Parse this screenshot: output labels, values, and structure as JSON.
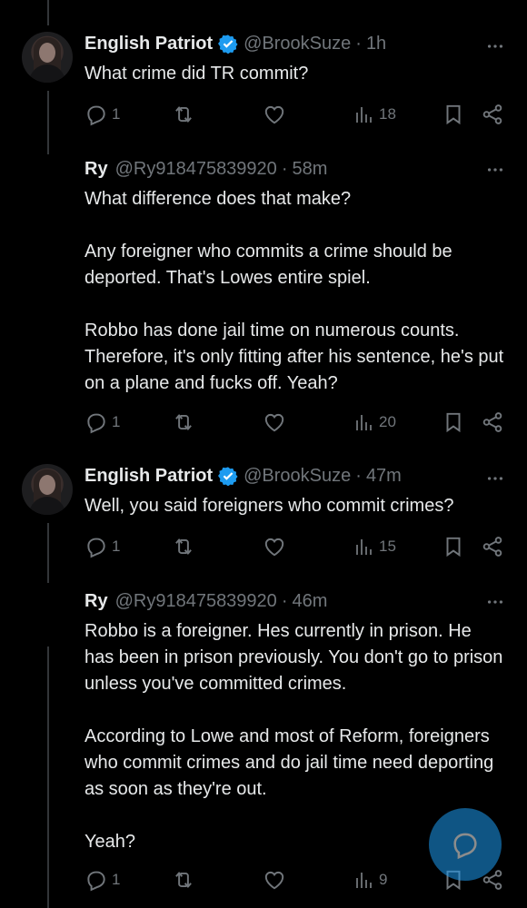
{
  "tweets": [
    {
      "name": "English Patriot",
      "verified": true,
      "handle": "@BrookSuze",
      "time": "1h",
      "text": "What crime did TR commit?",
      "replies": "1",
      "views": "18"
    },
    {
      "name": "Ry",
      "verified": false,
      "handle": "@Ry918475839920",
      "time": "58m",
      "text": "What difference does that make?\n\nAny foreigner who commits a crime should be deported. That's Lowes entire spiel.\n\nRobbo has done jail time on numerous counts. Therefore, it's only fitting after his sentence, he's put on a plane and fucks off. Yeah?",
      "replies": "1",
      "views": "20"
    },
    {
      "name": "English Patriot",
      "verified": true,
      "handle": "@BrookSuze",
      "time": "47m",
      "text": "Well, you said foreigners who commit crimes?",
      "replies": "1",
      "views": "15"
    },
    {
      "name": "Ry",
      "verified": false,
      "handle": "@Ry918475839920",
      "time": "46m",
      "text": "Robbo is a foreigner. Hes currently in prison. He has been in prison previously. You don't go to prison unless you've committed crimes.\n\nAccording to Lowe and most of Reform, foreigners who commit crimes and do jail time need deporting as soon as they're out.\n\nYeah?",
      "replies": "1",
      "views": "9"
    }
  ],
  "separator": "·",
  "colors": {
    "background": "#000000",
    "text": "#e7e9ea",
    "muted": "#71767b",
    "accent": "#1d9bf0",
    "line": "#333639"
  },
  "icons": [
    "reply-icon",
    "retweet-icon",
    "like-icon",
    "views-icon",
    "bookmark-icon",
    "share-icon",
    "more-icon",
    "verified-icon",
    "compose-reply-icon"
  ]
}
